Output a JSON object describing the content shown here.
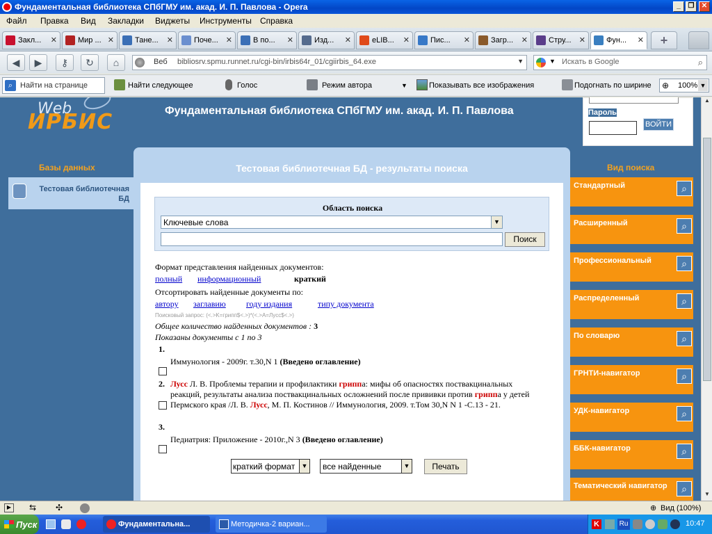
{
  "window": {
    "title": "Фундаментальная библиотека СПбГМУ им. акад. И. П. Павлова - Opera",
    "minimize": "_",
    "restore": "❐",
    "close": "✕"
  },
  "menu": [
    "Файл",
    "Правка",
    "Вид",
    "Закладки",
    "Виджеты",
    "Инструменты",
    "Справка"
  ],
  "tabs": [
    {
      "label": "Закл...",
      "color": "#c8102e"
    },
    {
      "label": "Мир ...",
      "color": "#b22222"
    },
    {
      "label": "Тане...",
      "color": "#3b6fb6"
    },
    {
      "label": "Поче...",
      "color": "#6b8fcf"
    },
    {
      "label": "В по...",
      "color": "#3b6fb6"
    },
    {
      "label": "Изд...",
      "color": "#556b8d"
    },
    {
      "label": "eLIB...",
      "color": "#e04a1a"
    },
    {
      "label": "Пис...",
      "color": "#3778c7"
    },
    {
      "label": "Загр...",
      "color": "#8a5a2b"
    },
    {
      "label": "Стру...",
      "color": "#5a3d8a"
    },
    {
      "label": "Фун...",
      "color": "#3a7fc0"
    }
  ],
  "address": {
    "label": "Веб",
    "url": "bibliosrv.spmu.runnet.ru/cgi-bin/irbis64r_01/cgiirbis_64.exe",
    "search_placeholder": "Искать в Google"
  },
  "toolbar": {
    "find_on_page": "Найти на странице",
    "find_next": "Найти следующее",
    "voice": "Голос",
    "author_mode": "Режим автора",
    "show_images": "Показывать все изображения",
    "fit_width": "Подогнать по ширине",
    "zoom": "100%"
  },
  "site": {
    "logo_web": "Web",
    "logo_irbis": "ИРБИС",
    "header_title": "Фундаментальная библиотека СПбГМУ им. акад. И. П. Павлова",
    "password_label": "Пароль",
    "login_button": "ВОЙТИ",
    "databases_heading": "Базы данных",
    "database_item": "Тестовая библиотечная БД",
    "search_type_heading": "Вид поиска",
    "search_types": [
      "Стандартный",
      "Расширенный",
      "Профессиональный",
      "Распределенный",
      "По словарю",
      "ГРНТИ-навигатор",
      "УДК-навигатор",
      "ББК-навигатор",
      "Тематический навигатор"
    ]
  },
  "results": {
    "panel_title": "Тестовая библиотечная БД - результаты поиска",
    "search_area_label": "Область поиска",
    "search_field_select": "Ключевые слова",
    "search_input_value": "",
    "search_button": "Поиск",
    "format_label": "Формат представления найденных документов:",
    "format_full": "полный",
    "format_info": "информационный",
    "format_brief": "краткий",
    "sort_label": "Отсортировать найденные документы по:",
    "sort_author": "автору",
    "sort_title": "заглавию",
    "sort_year": "году издания",
    "sort_type": "типу документа",
    "query_text": "Поисковый запрос: (<.>K=грипп$<.>)*(<.>A=Лусс$<.>)",
    "total_label": "Общее количество найденных документов :",
    "total_count": "3",
    "shown_text": "Показаны документы с 1 по 3",
    "docs": [
      {
        "num": "1.",
        "text": "Иммунология - 2009г. т.30,N 1",
        "bold": "(Введено оглавление)"
      },
      {
        "num": "2.",
        "p1": "Лусс",
        "p2": " Л. В. Проблемы терапии и профилактики ",
        "p3": "грипп",
        "p4": "а: мифы об опасностях поствакцинальных реакций, результаты анализа поствакцинальных осложнений после прививки против ",
        "p5": "грипп",
        "p6": "а у детей Пермского края /Л. В. ",
        "p7": "Лусс",
        "p8": ", М. П. Костинов // Иммунология, 2009. т.Том 30,N N 1 -С.13 - 21."
      },
      {
        "num": "3.",
        "text": "Педиатрия: Приложение - 2010г.,N 3",
        "bold": "(Введено оглавление)"
      }
    ],
    "bottom_format_select": "краткий формат",
    "bottom_scope_select": "все найденные",
    "print_button": "Печать"
  },
  "status": {
    "view_zoom": "Вид (100%)"
  },
  "taskbar": {
    "start": "Пуск",
    "task1": "Фундаментальна...",
    "task2": "Методичка-2 вариан...",
    "clock": "10:47",
    "lang": "Ru"
  }
}
